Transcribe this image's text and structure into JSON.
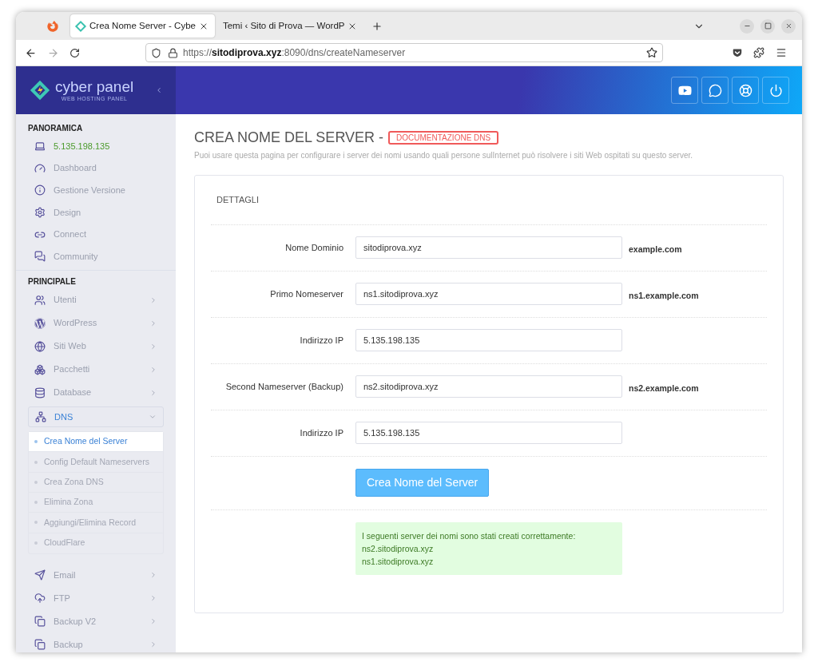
{
  "browser": {
    "tabs": [
      {
        "title": "Crea Nome Server - Cybe",
        "selected": true
      },
      {
        "title": "Temi ‹ Sito di Prova — WordP",
        "selected": false
      }
    ],
    "url": {
      "scheme": "https://",
      "host": "sitodiprova.xyz",
      "path": ":8090/dns/createNameserver"
    }
  },
  "logo": {
    "name": "cyber panel",
    "tagline": "WEB HOSTING PANEL"
  },
  "sidebar": [
    {
      "heading": "PANORAMICA",
      "items": [
        {
          "label": "5.135.198.135",
          "kind": "ip",
          "expandable": false
        },
        {
          "label": "Dashboard",
          "kind": "link",
          "expandable": false
        },
        {
          "label": "Gestione Versione",
          "kind": "link",
          "expandable": false
        },
        {
          "label": "Design",
          "kind": "link",
          "expandable": false
        },
        {
          "label": "Connect",
          "kind": "link",
          "expandable": false
        },
        {
          "label": "Community",
          "kind": "link",
          "expandable": false
        }
      ]
    },
    {
      "heading": "PRINCIPALE",
      "items": [
        {
          "label": "Utenti",
          "kind": "link",
          "expandable": true,
          "expanded": false
        },
        {
          "label": "WordPress",
          "kind": "link",
          "expandable": true,
          "expanded": false
        },
        {
          "label": "Siti Web",
          "kind": "link",
          "expandable": true,
          "expanded": false
        },
        {
          "label": "Pacchetti",
          "kind": "link",
          "expandable": true,
          "expanded": false
        },
        {
          "label": "Database",
          "kind": "link",
          "expandable": true,
          "expanded": false
        },
        {
          "label": "DNS",
          "kind": "link",
          "expandable": true,
          "expanded": true,
          "children": [
            {
              "label": "Crea Nome del Server",
              "selected": true
            },
            {
              "label": "Config Default Nameservers",
              "selected": false
            },
            {
              "label": "Crea Zona DNS",
              "selected": false
            },
            {
              "label": "Elimina Zona",
              "selected": false
            },
            {
              "label": "Aggiungi/Elimina Record",
              "selected": false
            },
            {
              "label": "CloudFlare",
              "selected": false
            }
          ]
        },
        {
          "label": "Email",
          "kind": "link",
          "expandable": true,
          "expanded": false
        },
        {
          "label": "FTP",
          "kind": "link",
          "expandable": true,
          "expanded": false
        },
        {
          "label": "Backup V2",
          "kind": "link",
          "expandable": true,
          "expanded": false
        },
        {
          "label": "Backup",
          "kind": "link",
          "expandable": true,
          "expanded": false
        }
      ]
    }
  ],
  "page": {
    "title": "CREA NOME DEL SERVER -",
    "doc_link": "DOCUMENTAZIONE DNS",
    "description": "Puoi usare questa pagina per configurare i server dei nomi usando quali persone sulInternet può risolvere i siti Web ospitati su questo server."
  },
  "card": {
    "heading": "DETTAGLI",
    "fields": [
      {
        "label": "Nome Dominio",
        "value": "sitodiprova.xyz",
        "hint": "example.com"
      },
      {
        "label": "Primo Nomeserver",
        "value": "ns1.sitodiprova.xyz",
        "hint": "ns1.example.com"
      },
      {
        "label": "Indirizzo IP",
        "value": "5.135.198.135"
      },
      {
        "label": "Second Nameserver (Backup)",
        "value": "ns2.sitodiprova.xyz",
        "hint": "ns2.example.com"
      },
      {
        "label": "Indirizzo IP",
        "value": "5.135.198.135"
      }
    ],
    "button": "Crea Nome del Server",
    "alert": {
      "kind": "success",
      "lines": [
        "I seguenti server dei nomi sono stati creati correttamente:",
        "ns2.sitodiprova.xyz",
        "ns1.sitodiprova.xyz"
      ]
    }
  }
}
